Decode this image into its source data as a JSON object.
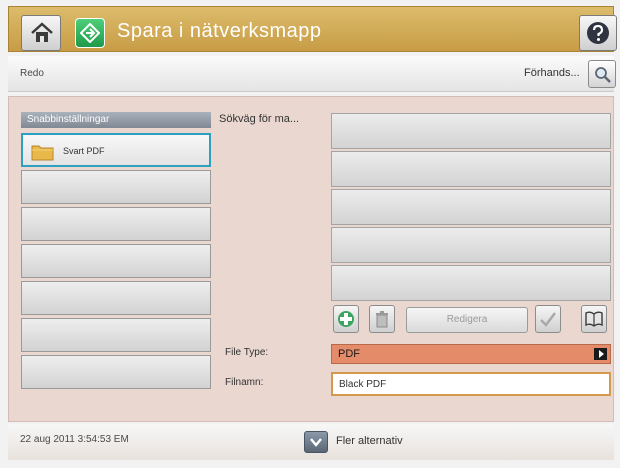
{
  "header": {
    "title": "Spara i nätverksmapp"
  },
  "status": {
    "text": "Redo",
    "preview_label": "Förhands..."
  },
  "quick_sets": {
    "header": "Snabbinställningar",
    "items": [
      "Svart PDF"
    ]
  },
  "folder_path": {
    "label": "Sökväg för ma..."
  },
  "toolbar": {
    "edit_label": "Redigera"
  },
  "file_type": {
    "label": "File Type:",
    "value": "PDF"
  },
  "file_name": {
    "label": "Filnamn:",
    "value": "Black PDF"
  },
  "footer": {
    "datetime": "22 aug 2011 3:54:53 EM",
    "more_options": "Fler alternativ"
  },
  "colors": {
    "title_bar": "#d5b05e",
    "selection_border": "#2fa0c0",
    "file_type_fill": "#e48c69",
    "panel_background": "#e9d7d0"
  }
}
